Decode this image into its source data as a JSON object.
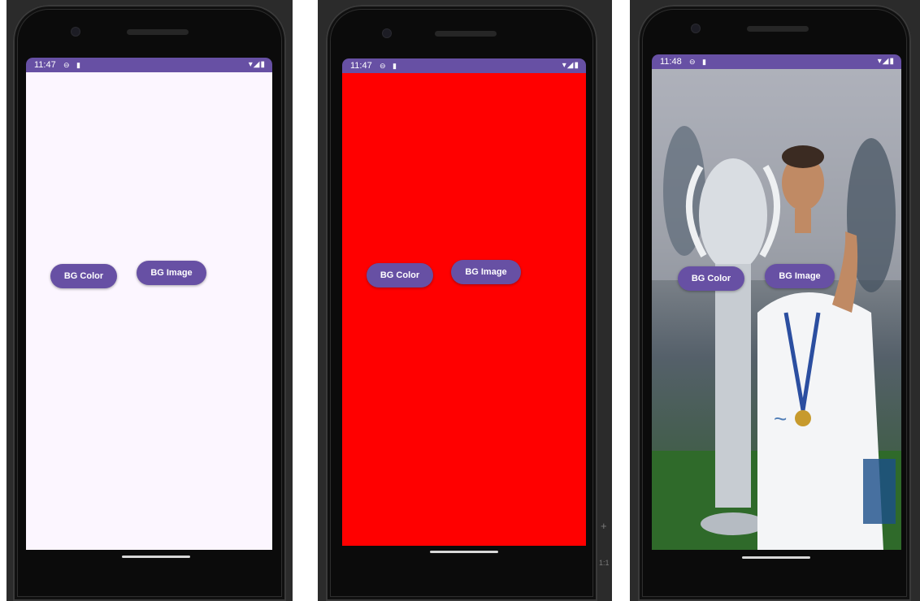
{
  "screens": [
    {
      "time": "11:47",
      "background": "#fcf6ff",
      "buttons": {
        "bg_color": "BG Color",
        "bg_image": "BG Image"
      }
    },
    {
      "time": "11:47",
      "background": "#ff0000",
      "buttons": {
        "bg_color": "BG Color",
        "bg_image": "BG Image"
      }
    },
    {
      "time": "11:48",
      "background": "photo",
      "buttons": {
        "bg_color": "BG Color",
        "bg_image": "BG Image"
      }
    }
  ],
  "colors": {
    "accent": "#6750a4",
    "status_bar": "#6750a4"
  },
  "side_panel": {
    "zoom_in": "+",
    "ratio": "1:1"
  }
}
